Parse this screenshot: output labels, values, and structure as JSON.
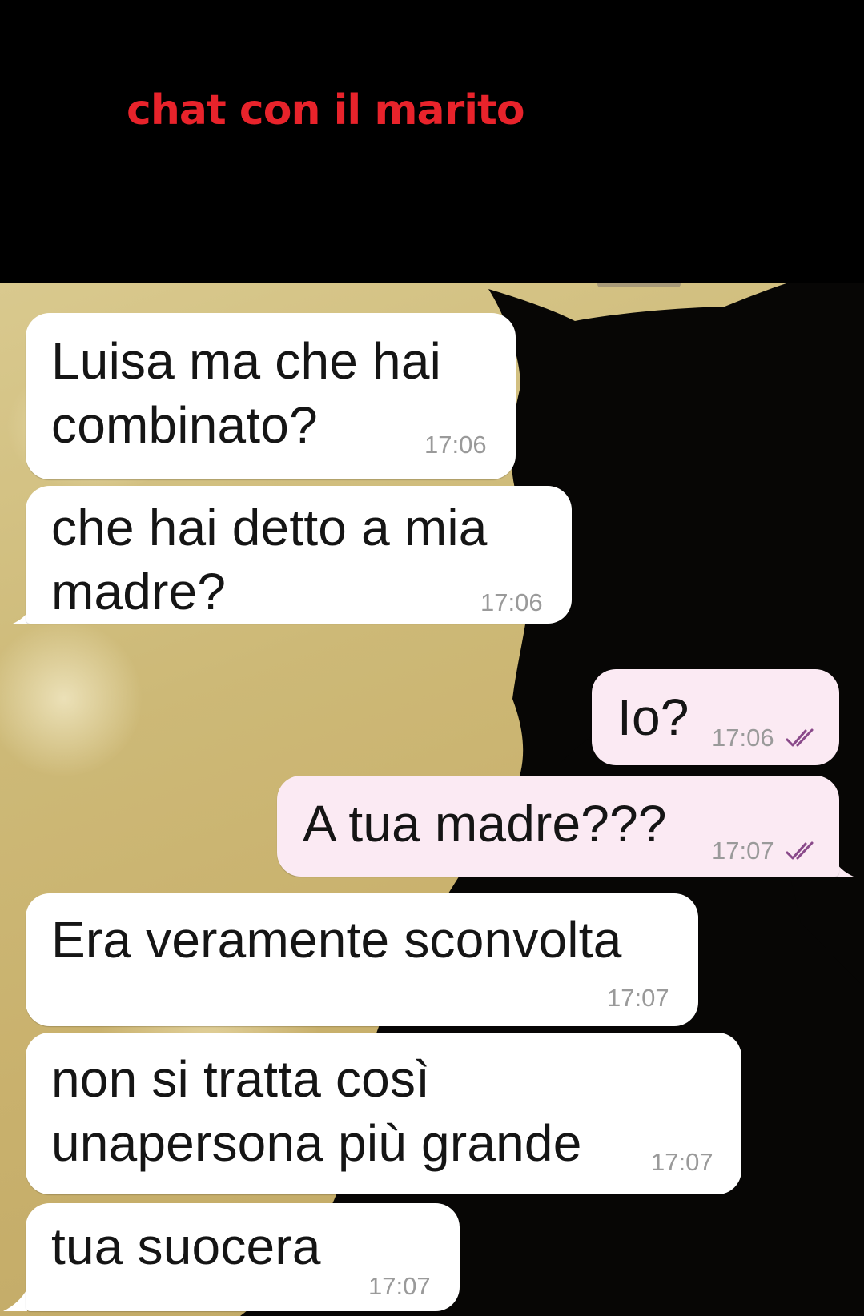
{
  "header": {
    "title": "chat con il marito"
  },
  "colors": {
    "title": "#e8232b",
    "incoming_bubble": "#ffffff",
    "outgoing_bubble": "#fbeaf3",
    "read_ticks": "#8a4a8a",
    "wallpaper": "#cdb977"
  },
  "messages": [
    {
      "direction": "incoming",
      "text": "Luisa ma che hai\ncombinato?",
      "time": "17:06"
    },
    {
      "direction": "incoming",
      "text": "che hai detto a mia\nmadre?",
      "time": "17:06"
    },
    {
      "direction": "outgoing",
      "text": "Io?",
      "time": "17:06",
      "status_icon": "double-check-icon"
    },
    {
      "direction": "outgoing",
      "text": "A tua madre???",
      "time": "17:07",
      "status_icon": "double-check-icon"
    },
    {
      "direction": "incoming",
      "text": "Era veramente sconvolta",
      "time": "17:07"
    },
    {
      "direction": "incoming",
      "text": "non si tratta così\nunapersona più grande",
      "time": "17:07"
    },
    {
      "direction": "incoming",
      "text": "tua suocera",
      "time": "17:07"
    }
  ]
}
